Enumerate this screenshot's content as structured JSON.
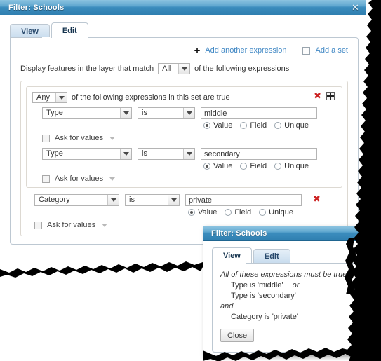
{
  "window": {
    "title": "Filter: Schools",
    "close_icon": "close-icon",
    "tabs": [
      {
        "label": "View",
        "active": false
      },
      {
        "label": "Edit",
        "active": true
      }
    ]
  },
  "toolbar": {
    "add_expression_icon": "plus-icon",
    "add_expression_label": "Add another expression",
    "add_set_checkbox": false,
    "add_set_label": "Add a set"
  },
  "match_row": {
    "prefix": "Display features in the layer that match",
    "match_value": "All",
    "suffix": "of the following expressions"
  },
  "set": {
    "match_value": "Any",
    "label": "of the following expressions in this set are true",
    "remove_icon": "remove-set-icon",
    "add_icon": "add-to-set-icon",
    "expressions": [
      {
        "field": "Type",
        "operator": "is",
        "value": "middle",
        "value_mode": "Value",
        "modes": [
          "Value",
          "Field",
          "Unique"
        ],
        "ask_for_values": false,
        "ask_label": "Ask for values"
      },
      {
        "field": "Type",
        "operator": "is",
        "value": "secondary",
        "value_mode": "Value",
        "modes": [
          "Value",
          "Field",
          "Unique"
        ],
        "ask_for_values": false,
        "ask_label": "Ask for values"
      }
    ]
  },
  "standalone_expression": {
    "field": "Category",
    "operator": "is",
    "value": "private",
    "value_mode": "Value",
    "modes": [
      "Value",
      "Field",
      "Unique"
    ],
    "ask_for_values": false,
    "ask_label": "Ask for values",
    "remove_icon": "remove-expression-icon"
  },
  "inner_dialog": {
    "title": "Filter: Schools",
    "tabs": [
      {
        "label": "View",
        "active": true
      },
      {
        "label": "Edit",
        "active": false
      }
    ],
    "summary_heading": "All of these expressions must be true:",
    "line1": "Type is 'middle'",
    "line1_conj": "or",
    "line2": "Type is 'secondary'",
    "conjunction": "and",
    "line3": "Category is 'private'",
    "close_label": "Close"
  },
  "colors": {
    "titlebar_blue": "#3b8cbd",
    "link_blue": "#3f87c4",
    "remove_red": "#cc2222",
    "tab_inactive": "#c9ddee",
    "panel_border": "#bdc8d2"
  }
}
